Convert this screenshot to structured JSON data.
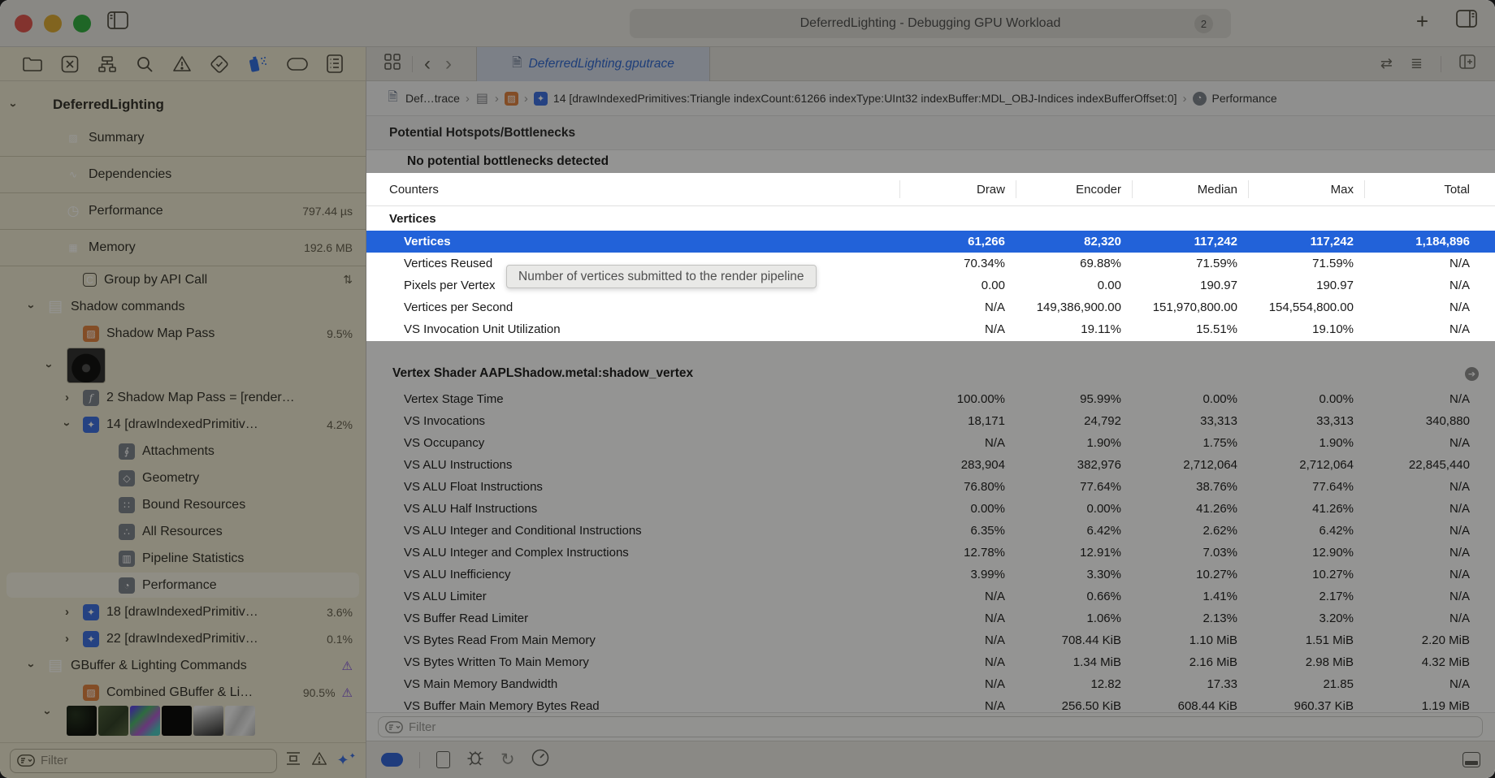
{
  "window": {
    "title": "DeferredLighting - Debugging GPU Workload",
    "tab_count_badge": "2"
  },
  "tabbar": {
    "tab_label": "DeferredLighting.gputrace"
  },
  "breadcrumb": {
    "first": "Def…trace",
    "draw_call": "14 [drawIndexedPrimitives:Triangle indexCount:61266 indexType:UInt32 indexBuffer:MDL_OBJ-Indices indexBufferOffset:0]",
    "last": "Performance",
    "separator": "›"
  },
  "hotspots": {
    "header": "Potential Hotspots/Bottlenecks",
    "message": "No potential bottlenecks detected"
  },
  "tooltip": {
    "text": "Number of vertices submitted to the render pipeline"
  },
  "counters": {
    "label_col": "Counters",
    "value_cols": [
      {
        "label": "Draw"
      },
      {
        "label": "Encoder"
      },
      {
        "label": "Median"
      },
      {
        "label": "Max"
      },
      {
        "label": "Total"
      }
    ],
    "rows": [
      {
        "type": "section",
        "label": "Vertices",
        "selected": false
      },
      {
        "type": "row",
        "label": "Vertices",
        "selected": true,
        "values": [
          "61,266",
          "82,320",
          "117,242",
          "117,242",
          "1,184,896"
        ]
      },
      {
        "type": "row",
        "label": "Vertices Reused",
        "selected": false,
        "values": [
          "70.34%",
          "69.88%",
          "71.59%",
          "71.59%",
          "N/A"
        ]
      },
      {
        "type": "row",
        "label": "Pixels per Vertex",
        "selected": false,
        "values": [
          "0.00",
          "0.00",
          "190.97",
          "190.97",
          "N/A"
        ]
      },
      {
        "type": "row",
        "label": "Vertices per Second",
        "selected": false,
        "values": [
          "N/A",
          "149,386,900.00",
          "151,970,800.00",
          "154,554,800.00",
          "N/A"
        ]
      },
      {
        "type": "row",
        "label": "VS Invocation Unit Utilization",
        "selected": false,
        "values": [
          "N/A",
          "19.11%",
          "15.51%",
          "19.10%",
          "N/A"
        ]
      }
    ]
  },
  "vertex_shader": {
    "title": "Vertex Shader  AAPLShadow.metal:shadow_vertex",
    "rows": [
      {
        "type": "row",
        "label": "Vertex Stage Time",
        "values": [
          "100.00%",
          "95.99%",
          "0.00%",
          "0.00%",
          "N/A"
        ]
      },
      {
        "type": "row",
        "label": "VS Invocations",
        "values": [
          "18,171",
          "24,792",
          "33,313",
          "33,313",
          "340,880"
        ]
      },
      {
        "type": "row",
        "label": "VS Occupancy",
        "values": [
          "N/A",
          "1.90%",
          "1.75%",
          "1.90%",
          "N/A"
        ]
      },
      {
        "type": "row",
        "label": "VS ALU Instructions",
        "values": [
          "283,904",
          "382,976",
          "2,712,064",
          "2,712,064",
          "22,845,440"
        ]
      },
      {
        "type": "row",
        "label": "VS ALU Float Instructions",
        "values": [
          "76.80%",
          "77.64%",
          "38.76%",
          "77.64%",
          "N/A"
        ]
      },
      {
        "type": "row",
        "label": "VS ALU Half Instructions",
        "values": [
          "0.00%",
          "0.00%",
          "41.26%",
          "41.26%",
          "N/A"
        ]
      },
      {
        "type": "row",
        "label": "VS ALU Integer and Conditional Instructions",
        "values": [
          "6.35%",
          "6.42%",
          "2.62%",
          "6.42%",
          "N/A"
        ]
      },
      {
        "type": "row",
        "label": "VS ALU Integer and Complex Instructions",
        "values": [
          "12.78%",
          "12.91%",
          "7.03%",
          "12.90%",
          "N/A"
        ]
      },
      {
        "type": "row",
        "label": "VS ALU Inefficiency",
        "values": [
          "3.99%",
          "3.30%",
          "10.27%",
          "10.27%",
          "N/A"
        ]
      },
      {
        "type": "row",
        "label": "VS ALU Limiter",
        "values": [
          "N/A",
          "0.66%",
          "1.41%",
          "2.17%",
          "N/A"
        ]
      },
      {
        "type": "row",
        "label": "VS Buffer Read Limiter",
        "values": [
          "N/A",
          "1.06%",
          "2.13%",
          "3.20%",
          "N/A"
        ]
      },
      {
        "type": "row",
        "label": "VS Bytes Read From Main Memory",
        "values": [
          "N/A",
          "708.44 KiB",
          "1.10 MiB",
          "1.51 MiB",
          "2.20 MiB"
        ]
      },
      {
        "type": "row",
        "label": "VS Bytes Written To Main Memory",
        "values": [
          "N/A",
          "1.34 MiB",
          "2.16 MiB",
          "2.98 MiB",
          "4.32 MiB"
        ]
      },
      {
        "type": "row",
        "label": "VS Main Memory Bandwidth",
        "values": [
          "N/A",
          "12.82",
          "17.33",
          "21.85",
          "N/A"
        ]
      },
      {
        "type": "row",
        "label": "VS Buffer Main Memory Bytes Read",
        "values": [
          "N/A",
          "256.50 KiB",
          "608.44 KiB",
          "960.37 KiB",
          "1.19 MiB"
        ]
      }
    ]
  },
  "sidebar": {
    "filter_placeholder": "Filter",
    "tree_a": [
      {
        "label": "DeferredLighting",
        "level": 0,
        "row": "root",
        "chevron": "down",
        "icon": "",
        "detail": "",
        "warn": false,
        "selected": false
      },
      {
        "label": "Summary",
        "level": 2,
        "row": "big",
        "chevron": "",
        "icon": "photo",
        "detail": "",
        "warn": false,
        "selected": false
      },
      {
        "label": "Dependencies",
        "level": 2,
        "row": "big",
        "chevron": "",
        "icon": "deps",
        "detail": "",
        "warn": false,
        "selected": false
      },
      {
        "label": "Performance",
        "level": 2,
        "row": "big",
        "chevron": "",
        "icon": "clock",
        "detail": "797.44 µs",
        "warn": false,
        "selected": false
      },
      {
        "label": "Memory",
        "level": 2,
        "row": "big",
        "chevron": "",
        "icon": "chip",
        "detail": "192.6 MB",
        "warn": false,
        "selected": false
      },
      {
        "label": "Group by API Call",
        "level": 3,
        "row": "",
        "chevron": "",
        "icon": "c-square",
        "detail": "⇅",
        "warn": false,
        "selected": false
      },
      {
        "label": "Shadow commands",
        "level": 1,
        "row": "",
        "chevron": "down",
        "icon": "tray",
        "detail": "",
        "warn": false,
        "selected": false
      },
      {
        "label": "Shadow Map Pass",
        "level": 3,
        "row": "",
        "chevron": "",
        "icon": "render-pass",
        "detail": "9.5%",
        "warn": false,
        "selected": false
      }
    ],
    "tree_b": [
      {
        "label": "2 Shadow Map Pass = [render…",
        "level": 3,
        "row": "",
        "chevron": "right",
        "icon": "func",
        "detail": "",
        "warn": false,
        "selected": false
      },
      {
        "label": "14 [drawIndexedPrimitiv…",
        "level": 3,
        "row": "",
        "chevron": "down",
        "icon": "sparkle",
        "detail": "4.2%",
        "warn": false,
        "selected": false
      },
      {
        "label": "Attachments",
        "level": 5,
        "row": "",
        "chevron": "",
        "icon": "attach",
        "detail": "",
        "warn": false,
        "selected": false
      },
      {
        "label": "Geometry",
        "level": 5,
        "row": "",
        "chevron": "",
        "icon": "geometry",
        "detail": "",
        "warn": false,
        "selected": false
      },
      {
        "label": "Bound Resources",
        "level": 5,
        "row": "",
        "chevron": "",
        "icon": "bound-res",
        "detail": "",
        "warn": false,
        "selected": false
      },
      {
        "label": "All Resources",
        "level": 5,
        "row": "",
        "chevron": "",
        "icon": "all-res",
        "detail": "",
        "warn": false,
        "selected": false
      },
      {
        "label": "Pipeline Statistics",
        "level": 5,
        "row": "",
        "chevron": "",
        "icon": "pipeline",
        "detail": "",
        "warn": false,
        "selected": false
      },
      {
        "label": "Performance",
        "level": 5,
        "row": "",
        "chevron": "",
        "icon": "gauge",
        "detail": "",
        "warn": false,
        "selected": true
      },
      {
        "label": "18 [drawIndexedPrimitiv…",
        "level": 3,
        "row": "",
        "chevron": "right",
        "icon": "sparkle",
        "detail": "3.6%",
        "warn": false,
        "selected": false
      },
      {
        "label": "22 [drawIndexedPrimitiv…",
        "level": 3,
        "row": "",
        "chevron": "right",
        "icon": "sparkle",
        "detail": "0.1%",
        "warn": false,
        "selected": false
      },
      {
        "label": "GBuffer & Lighting Commands",
        "level": 1,
        "row": "",
        "chevron": "down",
        "icon": "tray",
        "detail": "",
        "warn": true,
        "selected": false
      },
      {
        "label": "Combined GBuffer & Li…",
        "level": 3,
        "row": "",
        "chevron": "",
        "icon": "render-pass",
        "detail": "90.5%",
        "warn": true,
        "selected": false
      }
    ]
  },
  "main_filter": {
    "placeholder": "Filter"
  },
  "colors": {
    "selection_blue": "#2262d9",
    "accent_blue": "#3a6de0",
    "warning_purple": "#7d4fd8",
    "render_pass_orange": "#e0813d"
  }
}
